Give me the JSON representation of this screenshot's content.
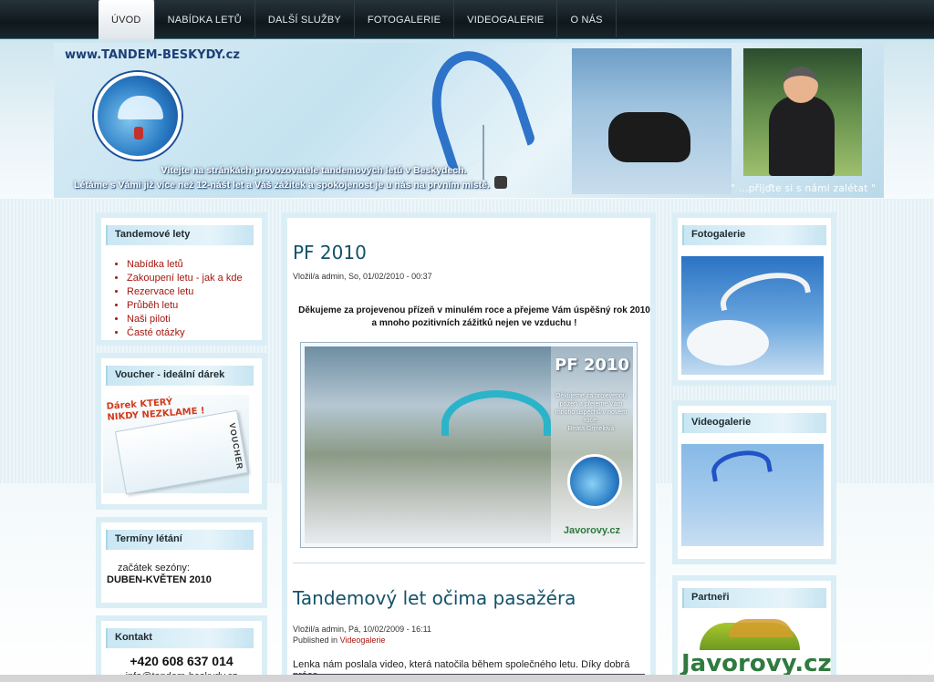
{
  "nav": {
    "items": [
      {
        "label": "ÚVOD",
        "active": true
      },
      {
        "label": "NABÍDKA LETŮ",
        "active": false
      },
      {
        "label": "DALŠÍ SLUŽBY",
        "active": false
      },
      {
        "label": "FOTOGALERIE",
        "active": false
      },
      {
        "label": "VIDEOGALERIE",
        "active": false
      },
      {
        "label": "O NÁS",
        "active": false
      }
    ]
  },
  "header": {
    "site_url": "www.TANDEM-BESKYDY.cz",
    "welcome_line1": "Vítejte na stránkách provozovatele tandemových letů  v Beskydech.",
    "welcome_line2": "Létáme s Vámi již více než 12-nášt let a Váš zážitek a spokojenost je u nás na prvním místě.",
    "quote": "\" ...přijďte si s námi zalétat  \""
  },
  "left": {
    "tandem": {
      "title": "Tandemové lety",
      "items": [
        "Nabídka letů",
        "Zakoupení letu - jak a kde",
        "Rezervace letu",
        "Průběh letu",
        "Naši piloti",
        "Časté otázky"
      ]
    },
    "voucher": {
      "title": "Voucher - ideální dárek",
      "promo": "Dárek KTERÝ NIKDY NEZKLAME !",
      "card_label": "VOUCHER"
    },
    "terms": {
      "title": "Termíny létání",
      "label": "začátek sezóny:",
      "value": "DUBEN-KVĚTEN 2010"
    },
    "contact": {
      "title": "Kontakt",
      "phone": "+420 608 637 014",
      "email": "info@tandem-beskydy.cz"
    }
  },
  "main": {
    "post1": {
      "title": "PF 2010",
      "meta": "Vložil/a admin, So, 01/02/2010 - 00:37",
      "body": "Děkujeme za projevenou přízeň v minulém roce a přejeme Vám úspěšný rok 2010 a mnoho pozitivních zážitků nejen ve vzduchu !",
      "image_heading": "PF 2010",
      "image_text": "Děkujeme za projevenou přízeň a přejeme Vám mnoho úspěchů v novém roce.",
      "image_sign": "Beata Grmelová",
      "image_brand": "Javorovy.cz"
    },
    "post2": {
      "title": "Tandemový let očima pasažéra",
      "meta": "Vložil/a admin, Pá, 10/02/2009 - 16:11",
      "published_prefix": "Published in",
      "published_link": "Videogalerie",
      "intro": "Lenka nám poslala video, která natočila během společného letu. Díky dobrá práce"
    }
  },
  "right": {
    "photo": {
      "title": "Fotogalerie"
    },
    "video": {
      "title": "Videogalerie"
    },
    "partners": {
      "title": "Partneři",
      "logo_text": "Javorovy.cz"
    }
  },
  "colors": {
    "link": "#a4170f",
    "title": "#13526a",
    "nav_bg": "#0f181c"
  }
}
